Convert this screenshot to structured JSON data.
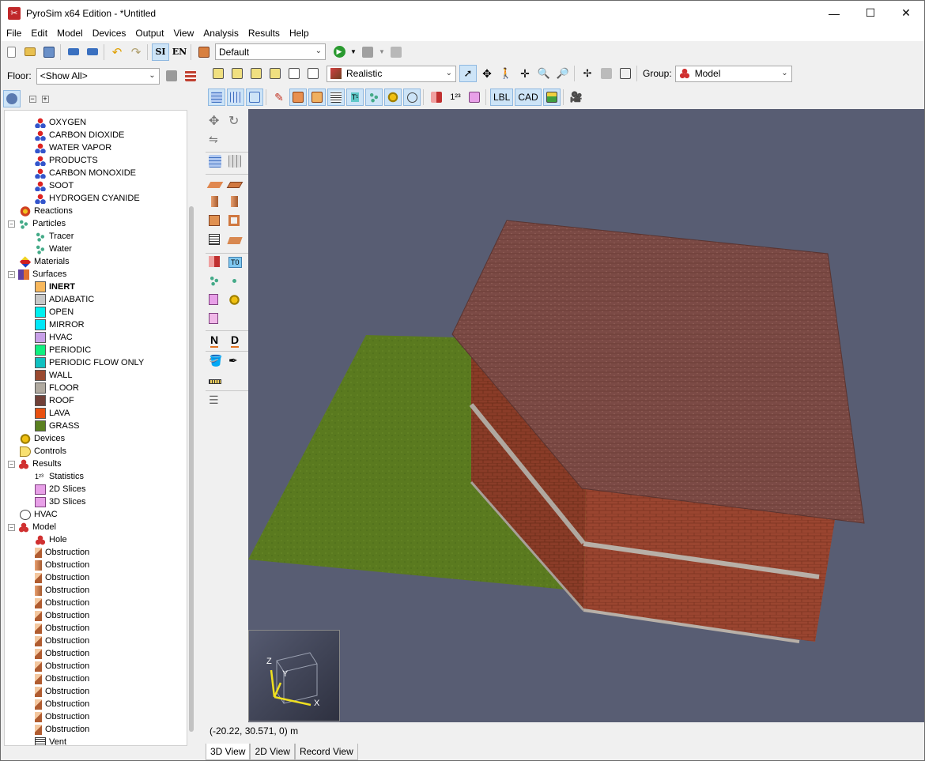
{
  "window": {
    "title": "PyroSim x64 Edition - *Untitled",
    "minimize": "—",
    "maximize": "☐",
    "close": "✕"
  },
  "menu": [
    "File",
    "Edit",
    "Model",
    "Devices",
    "Output",
    "View",
    "Analysis",
    "Results",
    "Help"
  ],
  "toolbar": {
    "unit_si": "SI",
    "unit_en": "EN",
    "scenario": "Default"
  },
  "floor": {
    "label": "Floor:",
    "value": "<Show All>"
  },
  "tree": {
    "species": [
      "OXYGEN",
      "CARBON DIOXIDE",
      "WATER VAPOR",
      "PRODUCTS",
      "CARBON MONOXIDE",
      "SOOT",
      "HYDROGEN CYANIDE"
    ],
    "reactions": "Reactions",
    "particles": {
      "label": "Particles",
      "children": [
        "Tracer",
        "Water"
      ]
    },
    "materials": "Materials",
    "surfaces": {
      "label": "Surfaces",
      "children": [
        {
          "label": "INERT",
          "color": "#f8b85c"
        },
        {
          "label": "ADIABATIC",
          "color": "#c8c8c8"
        },
        {
          "label": "OPEN",
          "color": "#00f0f0"
        },
        {
          "label": "MIRROR",
          "color": "#00e8f8"
        },
        {
          "label": "HVAC",
          "color": "#c8a0e8"
        },
        {
          "label": "PERIODIC",
          "color": "#10f080"
        },
        {
          "label": "PERIODIC FLOW ONLY",
          "color": "#10c0c0"
        },
        {
          "label": "WALL",
          "color": "#9a4a30"
        },
        {
          "label": "FLOOR",
          "color": "#b0aaa0"
        },
        {
          "label": "ROOF",
          "color": "#704038"
        },
        {
          "label": "LAVA",
          "color": "#e85010"
        },
        {
          "label": "GRASS",
          "color": "#5a8020"
        }
      ]
    },
    "devices": "Devices",
    "controls": "Controls",
    "results": {
      "label": "Results",
      "children": [
        "Statistics",
        "2D Slices",
        "3D Slices"
      ]
    },
    "hvac": "HVAC",
    "model": {
      "label": "Model",
      "children": [
        "Hole",
        "Obstruction",
        "Obstruction",
        "Obstruction",
        "Obstruction",
        "Obstruction",
        "Obstruction",
        "Obstruction",
        "Obstruction",
        "Obstruction",
        "Obstruction",
        "Obstruction",
        "Obstruction",
        "Obstruction",
        "Obstruction",
        "Obstruction",
        "Vent"
      ]
    }
  },
  "view": {
    "render_mode": "Realistic",
    "group_label": "Group:",
    "group_value": "Model",
    "lbl_button": "LBL",
    "cad_button": "CAD",
    "n_button": "N",
    "d_button": "D",
    "t0_button": "T0",
    "stats_button": "1²³",
    "axes": {
      "x": "X",
      "y": "Y",
      "z": "Z"
    },
    "coords": "(-20.22, 30.571, 0) m",
    "tabs": [
      "3D View",
      "2D View",
      "Record View"
    ]
  },
  "colors": {
    "viewport_bg": "#585d73",
    "grass": "#5b7a1e",
    "brick": "#93412a",
    "roof": "#7a4a44",
    "accent": "#c0282a"
  }
}
